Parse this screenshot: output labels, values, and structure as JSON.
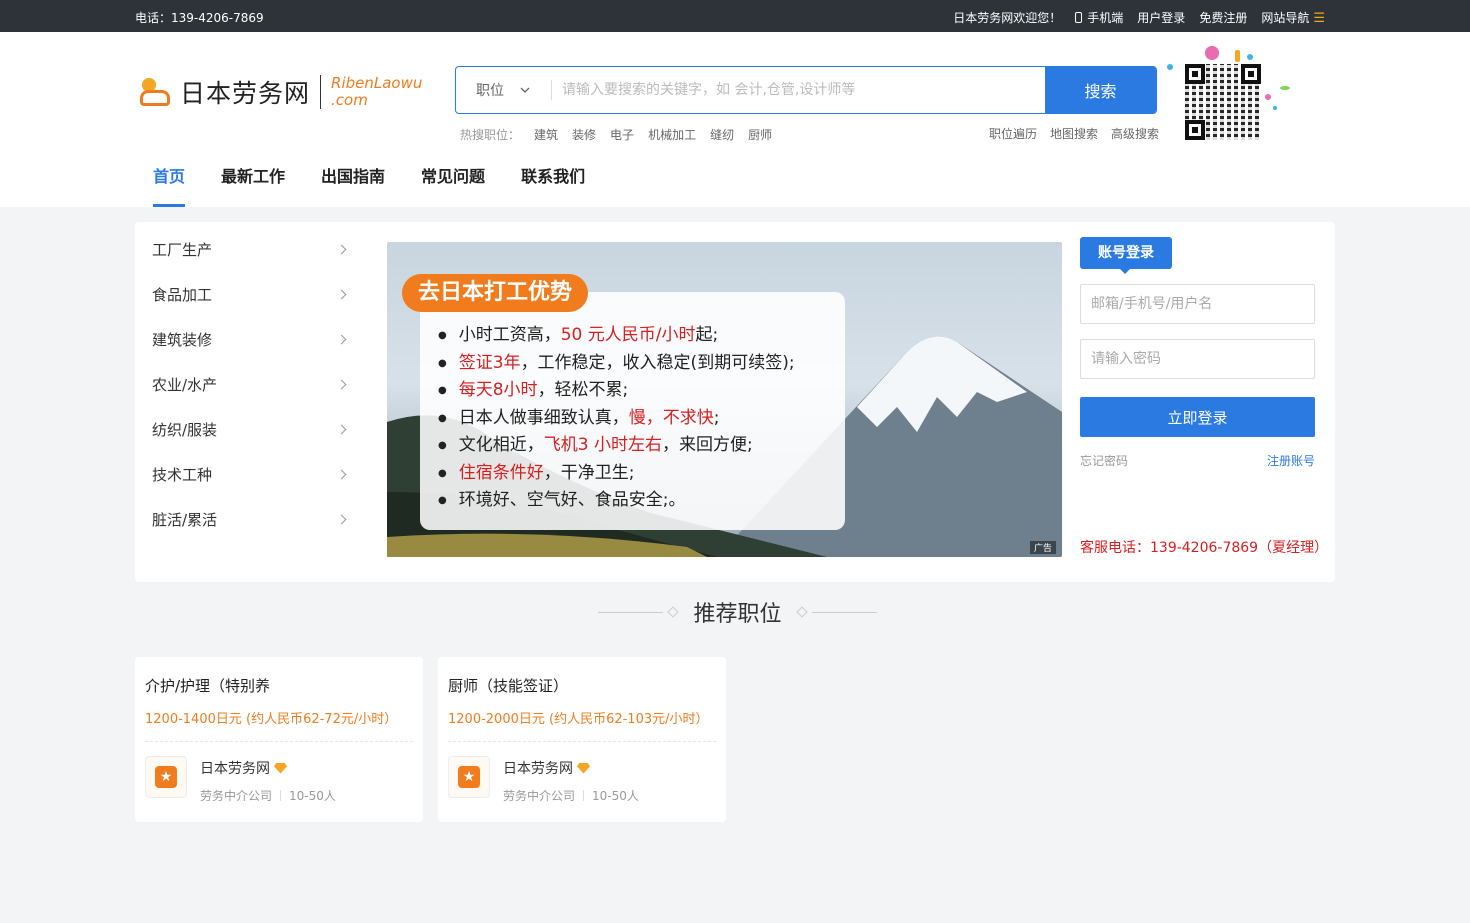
{
  "topbar": {
    "phone": "电话：139-4206-7869",
    "welcome": "日本劳务网欢迎您！",
    "mobile": "手机端",
    "login": "用户登录",
    "register": "免费注册",
    "sitemap": "网站导航"
  },
  "logo": {
    "cn": "日本劳务网",
    "en1": "RibenLaowu",
    "en2": ".com"
  },
  "search": {
    "category": "职位",
    "placeholder": "请输入要搜索的关键字，如 会计,仓管,设计师等",
    "button": "搜索"
  },
  "hot": {
    "label": "热搜职位：",
    "items": [
      "建筑",
      "装修",
      "电子",
      "机械加工",
      "缝纫",
      "厨师"
    ]
  },
  "quick": [
    "职位遍历",
    "地图搜索",
    "高级搜索"
  ],
  "nav": [
    "首页",
    "最新工作",
    "出国指南",
    "常见问题",
    "联系我们"
  ],
  "categories": [
    "工厂生产",
    "食品加工",
    "建筑装修",
    "农业/水产",
    "纺织/服装",
    "技术工种",
    "脏活/累活"
  ],
  "banner": {
    "title": "去日本打工优势",
    "ad": "广告",
    "l1a": "小时工资高，",
    "l1b": "50 元人民币/小时",
    "l1c": "起;",
    "l2a": "签证3年",
    "l2b": "，工作稳定，收入稳定(到期可续签);",
    "l3a": "每天8小时",
    "l3b": "，轻松不累;",
    "l4a": "日本人做事细致认真，",
    "l4b": "慢，不求快",
    "l4c": ";",
    "l5a": "文化相近，",
    "l5b": "飞机3 小时左右",
    "l5c": "，来回方便;",
    "l6a": "住宿条件好",
    "l6b": "，干净卫生;",
    "l7a": "环境好、空气好、食品安全;。"
  },
  "login": {
    "tab": "账号登录",
    "user_placeholder": "邮箱/手机号/用户名",
    "pass_placeholder": "请输入密码",
    "submit": "立即登录",
    "forgot": "忘记密码",
    "register": "注册账号",
    "service": "客服电话：139-4206-7869（夏经理）"
  },
  "section": {
    "title": "推荐职位"
  },
  "jobs": [
    {
      "title": "介护/护理（特别养",
      "salary": "1200-1400日元 (约人民币62-72元/小时）",
      "company": "日本劳务网",
      "type": "劳务中介公司",
      "size": "10-50人"
    },
    {
      "title": "厨师（技能签证）",
      "salary": "1200-2000日元 (约人民币62-103元/小时）",
      "company": "日本劳务网",
      "type": "劳务中介公司",
      "size": "10-50人"
    }
  ],
  "colors": {
    "primary": "#2a7ae2",
    "accent": "#f07c1e",
    "red": "#d81e1e"
  }
}
